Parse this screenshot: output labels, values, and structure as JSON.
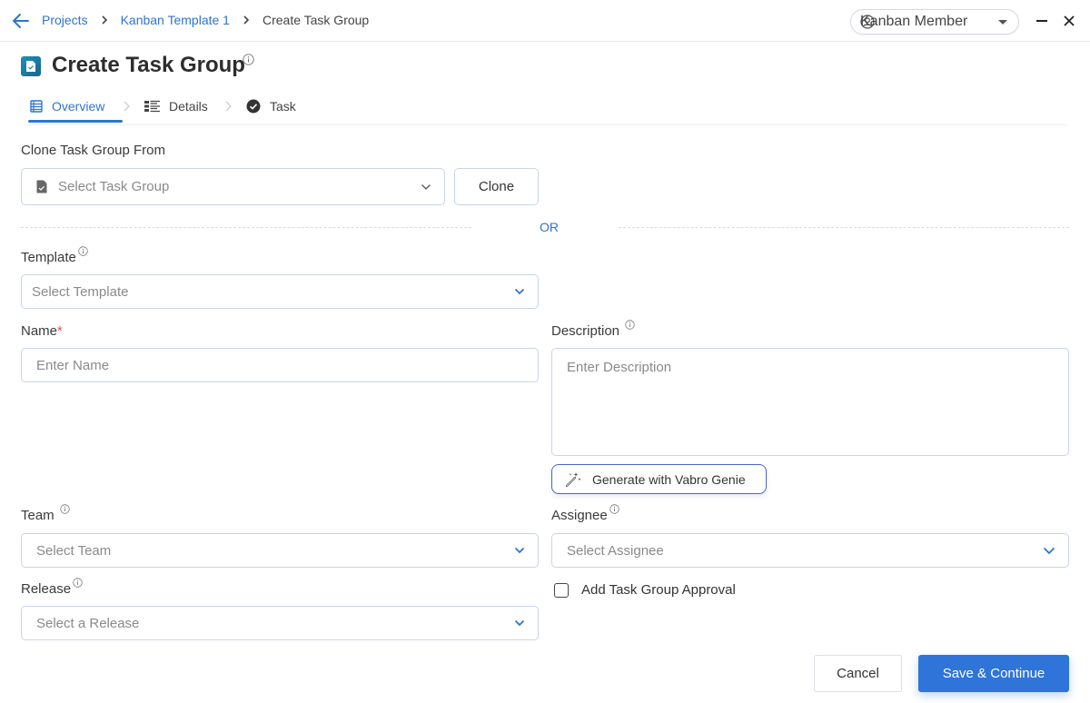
{
  "header": {
    "breadcrumbs": [
      "Projects",
      "Kanban Template 1"
    ],
    "current_page": "Create Task Group",
    "role_selector": "Kanban Member"
  },
  "page": {
    "title": "Create Task Group"
  },
  "steps": [
    {
      "label": "Overview",
      "icon": "list-icon",
      "active": true
    },
    {
      "label": "Details",
      "icon": "details-icon",
      "active": false
    },
    {
      "label": "Task",
      "icon": "check-circle-icon",
      "active": false
    }
  ],
  "form": {
    "clone_label": "Clone Task Group From",
    "clone_placeholder": "Select Task Group",
    "clone_button": "Clone",
    "or_text": "OR",
    "template_label": "Template",
    "template_placeholder": "Select Template",
    "name_label": "Name",
    "name_required": "*",
    "name_placeholder": "Enter Name",
    "description_label": "Description",
    "description_placeholder": "Enter Description",
    "genie_button": "Generate with Vabro Genie",
    "team_label": "Team",
    "team_placeholder": "Select Team",
    "assignee_label": "Assignee",
    "assignee_placeholder": "Select Assignee",
    "release_label": "Release",
    "release_placeholder": "Select a Release",
    "approval_label": "Add Task Group Approval",
    "approval_checked": false
  },
  "footer": {
    "cancel": "Cancel",
    "save": "Save & Continue"
  },
  "colors": {
    "accent": "#2f74d9",
    "link": "#2f74d0",
    "required": "#e05252"
  }
}
